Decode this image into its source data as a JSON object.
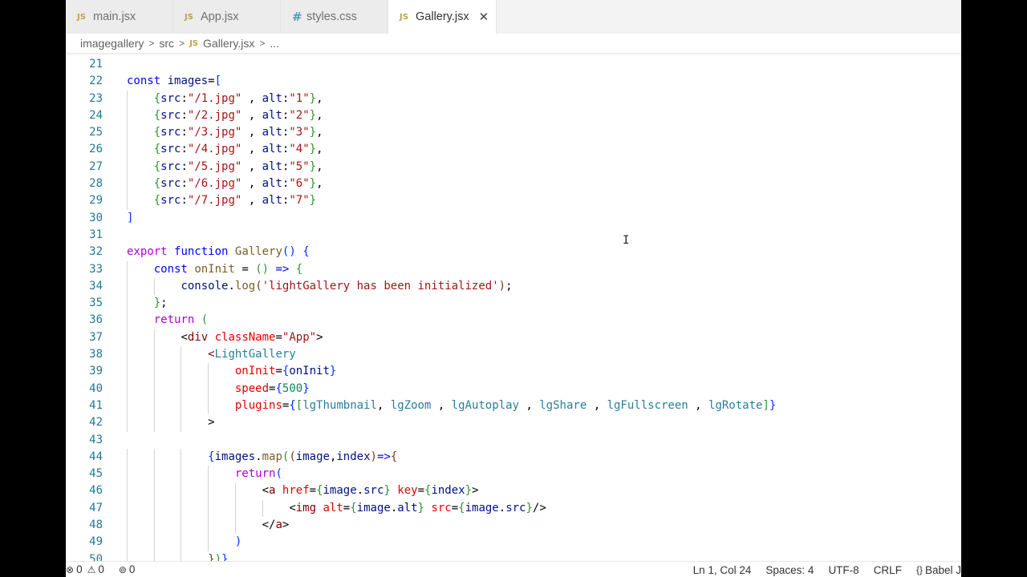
{
  "tabs": [
    {
      "icon": "JS",
      "label": "main.jsx",
      "active": false
    },
    {
      "icon": "JS",
      "label": "App.jsx",
      "active": false
    },
    {
      "icon": "#",
      "label": "styles.css",
      "active": false
    },
    {
      "icon": "JS",
      "label": "Gallery.jsx",
      "active": true,
      "close": "✕"
    }
  ],
  "breadcrumb": {
    "items": [
      "imagegallery",
      "src",
      "Gallery.jsx",
      "..."
    ],
    "file_icon": "JS",
    "separator": ">"
  },
  "editor": {
    "lines": [
      {
        "n": "21",
        "indent": 0,
        "tokens": []
      },
      {
        "n": "22",
        "indent": 0,
        "tokens": [
          [
            "kw",
            "const"
          ],
          [
            "plain",
            " "
          ],
          [
            "var",
            "images"
          ],
          [
            "plain",
            "="
          ],
          [
            "br1",
            "["
          ]
        ]
      },
      {
        "n": "23",
        "indent": 1,
        "tokens": [
          [
            "br2",
            "{"
          ],
          [
            "var",
            "src"
          ],
          [
            "plain",
            ":"
          ],
          [
            "str",
            "\"/1.jpg\""
          ],
          [
            "plain",
            " , "
          ],
          [
            "var",
            "alt"
          ],
          [
            "plain",
            ":"
          ],
          [
            "str",
            "\"1\""
          ],
          [
            "br2",
            "}"
          ],
          [
            "plain",
            ","
          ]
        ]
      },
      {
        "n": "24",
        "indent": 1,
        "tokens": [
          [
            "br2",
            "{"
          ],
          [
            "var",
            "src"
          ],
          [
            "plain",
            ":"
          ],
          [
            "str",
            "\"/2.jpg\""
          ],
          [
            "plain",
            " , "
          ],
          [
            "var",
            "alt"
          ],
          [
            "plain",
            ":"
          ],
          [
            "str",
            "\"2\""
          ],
          [
            "br2",
            "}"
          ],
          [
            "plain",
            ","
          ]
        ]
      },
      {
        "n": "25",
        "indent": 1,
        "tokens": [
          [
            "br2",
            "{"
          ],
          [
            "var",
            "src"
          ],
          [
            "plain",
            ":"
          ],
          [
            "str",
            "\"/3.jpg\""
          ],
          [
            "plain",
            " , "
          ],
          [
            "var",
            "alt"
          ],
          [
            "plain",
            ":"
          ],
          [
            "str",
            "\"3\""
          ],
          [
            "br2",
            "}"
          ],
          [
            "plain",
            ","
          ]
        ]
      },
      {
        "n": "26",
        "indent": 1,
        "tokens": [
          [
            "br2",
            "{"
          ],
          [
            "var",
            "src"
          ],
          [
            "plain",
            ":"
          ],
          [
            "str",
            "\"/4.jpg\""
          ],
          [
            "plain",
            " , "
          ],
          [
            "var",
            "alt"
          ],
          [
            "plain",
            ":"
          ],
          [
            "str",
            "\"4\""
          ],
          [
            "br2",
            "}"
          ],
          [
            "plain",
            ","
          ]
        ]
      },
      {
        "n": "27",
        "indent": 1,
        "tokens": [
          [
            "br2",
            "{"
          ],
          [
            "var",
            "src"
          ],
          [
            "plain",
            ":"
          ],
          [
            "str",
            "\"/5.jpg\""
          ],
          [
            "plain",
            " , "
          ],
          [
            "var",
            "alt"
          ],
          [
            "plain",
            ":"
          ],
          [
            "str",
            "\"5\""
          ],
          [
            "br2",
            "}"
          ],
          [
            "plain",
            ","
          ]
        ]
      },
      {
        "n": "28",
        "indent": 1,
        "tokens": [
          [
            "br2",
            "{"
          ],
          [
            "var",
            "src"
          ],
          [
            "plain",
            ":"
          ],
          [
            "str",
            "\"/6.jpg\""
          ],
          [
            "plain",
            " , "
          ],
          [
            "var",
            "alt"
          ],
          [
            "plain",
            ":"
          ],
          [
            "str",
            "\"6\""
          ],
          [
            "br2",
            "}"
          ],
          [
            "plain",
            ","
          ]
        ]
      },
      {
        "n": "29",
        "indent": 1,
        "tokens": [
          [
            "br2",
            "{"
          ],
          [
            "var",
            "src"
          ],
          [
            "plain",
            ":"
          ],
          [
            "str",
            "\"/7.jpg\""
          ],
          [
            "plain",
            " , "
          ],
          [
            "var",
            "alt"
          ],
          [
            "plain",
            ":"
          ],
          [
            "str",
            "\"7\""
          ],
          [
            "br2",
            "}"
          ]
        ]
      },
      {
        "n": "30",
        "indent": 0,
        "tokens": [
          [
            "br1",
            "]"
          ]
        ]
      },
      {
        "n": "31",
        "indent": 0,
        "tokens": []
      },
      {
        "n": "32",
        "indent": 0,
        "tokens": [
          [
            "kw2",
            "export"
          ],
          [
            "plain",
            " "
          ],
          [
            "kw",
            "function"
          ],
          [
            "plain",
            " "
          ],
          [
            "fn",
            "Gallery"
          ],
          [
            "br1",
            "()"
          ],
          [
            "plain",
            " "
          ],
          [
            "br1",
            "{"
          ]
        ]
      },
      {
        "n": "33",
        "indent": 1,
        "tokens": [
          [
            "kw",
            "const"
          ],
          [
            "plain",
            " "
          ],
          [
            "fn",
            "onInit"
          ],
          [
            "plain",
            " = "
          ],
          [
            "br2",
            "()"
          ],
          [
            "plain",
            " "
          ],
          [
            "kw",
            "=>"
          ],
          [
            "plain",
            " "
          ],
          [
            "br2",
            "{"
          ]
        ]
      },
      {
        "n": "34",
        "indent": 2,
        "tokens": [
          [
            "var",
            "console"
          ],
          [
            "plain",
            "."
          ],
          [
            "fn",
            "log"
          ],
          [
            "br3",
            "("
          ],
          [
            "str",
            "'lightGallery has been initialized'"
          ],
          [
            "br3",
            ")"
          ],
          [
            "plain",
            ";"
          ]
        ]
      },
      {
        "n": "35",
        "indent": 1,
        "tokens": [
          [
            "br2",
            "}"
          ],
          [
            "plain",
            ";"
          ]
        ]
      },
      {
        "n": "36",
        "indent": 1,
        "tokens": [
          [
            "kw2",
            "return"
          ],
          [
            "plain",
            " "
          ],
          [
            "br2",
            "("
          ]
        ]
      },
      {
        "n": "37",
        "indent": 2,
        "tokens": [
          [
            "plain",
            "<"
          ],
          [
            "tag",
            "div"
          ],
          [
            "plain",
            " "
          ],
          [
            "attr",
            "className"
          ],
          [
            "plain",
            "="
          ],
          [
            "str",
            "\"App\""
          ],
          [
            "plain",
            ">"
          ]
        ]
      },
      {
        "n": "38",
        "indent": 3,
        "tokens": [
          [
            "tag",
            "<"
          ],
          [
            "comp",
            "LightGallery"
          ]
        ]
      },
      {
        "n": "39",
        "indent": 4,
        "tokens": [
          [
            "attr",
            "onInit"
          ],
          [
            "plain",
            "="
          ],
          [
            "br1",
            "{"
          ],
          [
            "var",
            "onInit"
          ],
          [
            "br1",
            "}"
          ]
        ]
      },
      {
        "n": "40",
        "indent": 4,
        "tokens": [
          [
            "attr",
            "speed"
          ],
          [
            "plain",
            "="
          ],
          [
            "br1",
            "{"
          ],
          [
            "num",
            "500"
          ],
          [
            "br1",
            "}"
          ]
        ]
      },
      {
        "n": "41",
        "indent": 4,
        "tokens": [
          [
            "attr",
            "plugins"
          ],
          [
            "plain",
            "="
          ],
          [
            "br1",
            "{"
          ],
          [
            "br2",
            "["
          ],
          [
            "comp",
            "lgThumbnail"
          ],
          [
            "plain",
            ", "
          ],
          [
            "comp",
            "lgZoom"
          ],
          [
            "plain",
            " , "
          ],
          [
            "comp",
            "lgAutoplay"
          ],
          [
            "plain",
            " , "
          ],
          [
            "comp",
            "lgShare"
          ],
          [
            "plain",
            " , "
          ],
          [
            "comp",
            "lgFullscreen"
          ],
          [
            "plain",
            " , "
          ],
          [
            "comp",
            "lgRotate"
          ],
          [
            "br2",
            "]"
          ],
          [
            "br1",
            "}"
          ]
        ]
      },
      {
        "n": "42",
        "indent": 3,
        "tokens": [
          [
            "plain",
            ">"
          ]
        ]
      },
      {
        "n": "43",
        "indent": 0,
        "tokens": []
      },
      {
        "n": "44",
        "indent": 3,
        "tokens": [
          [
            "br1",
            "{"
          ],
          [
            "var",
            "images"
          ],
          [
            "plain",
            "."
          ],
          [
            "fn",
            "map"
          ],
          [
            "br2",
            "("
          ],
          [
            "br3",
            "("
          ],
          [
            "var",
            "image"
          ],
          [
            "plain",
            ","
          ],
          [
            "var",
            "index"
          ],
          [
            "br3",
            ")"
          ],
          [
            "kw",
            "=>"
          ],
          [
            "br3",
            "{"
          ]
        ]
      },
      {
        "n": "45",
        "indent": 4,
        "tokens": [
          [
            "kw2",
            "return"
          ],
          [
            "br1",
            "("
          ]
        ]
      },
      {
        "n": "46",
        "indent": 5,
        "tokens": [
          [
            "plain",
            "<"
          ],
          [
            "tag",
            "a"
          ],
          [
            "plain",
            " "
          ],
          [
            "attr",
            "href"
          ],
          [
            "plain",
            "="
          ],
          [
            "br2",
            "{"
          ],
          [
            "var",
            "image"
          ],
          [
            "plain",
            "."
          ],
          [
            "var",
            "src"
          ],
          [
            "br2",
            "}"
          ],
          [
            "plain",
            " "
          ],
          [
            "attr",
            "key"
          ],
          [
            "plain",
            "="
          ],
          [
            "br2",
            "{"
          ],
          [
            "var",
            "index"
          ],
          [
            "br2",
            "}"
          ],
          [
            "plain",
            ">"
          ]
        ]
      },
      {
        "n": "47",
        "indent": 6,
        "tokens": [
          [
            "plain",
            "<"
          ],
          [
            "tag",
            "img"
          ],
          [
            "plain",
            " "
          ],
          [
            "attr",
            "alt"
          ],
          [
            "plain",
            "="
          ],
          [
            "br2",
            "{"
          ],
          [
            "var",
            "image"
          ],
          [
            "plain",
            "."
          ],
          [
            "var",
            "alt"
          ],
          [
            "br2",
            "}"
          ],
          [
            "plain",
            " "
          ],
          [
            "attr",
            "src"
          ],
          [
            "plain",
            "="
          ],
          [
            "br2",
            "{"
          ],
          [
            "var",
            "image"
          ],
          [
            "plain",
            "."
          ],
          [
            "var",
            "src"
          ],
          [
            "br2",
            "}"
          ],
          [
            "plain",
            "/>"
          ]
        ]
      },
      {
        "n": "48",
        "indent": 5,
        "tokens": [
          [
            "plain",
            "</"
          ],
          [
            "tag",
            "a"
          ],
          [
            "plain",
            ">"
          ]
        ]
      },
      {
        "n": "49",
        "indent": 4,
        "tokens": [
          [
            "br1",
            ")"
          ]
        ]
      },
      {
        "n": "50",
        "indent": 3,
        "tokens": [
          [
            "br3",
            "}"
          ],
          [
            "br2",
            ")"
          ],
          [
            "br1",
            "}"
          ]
        ]
      }
    ]
  },
  "statusbar": {
    "errors": "0",
    "warnings": "0",
    "ports": "0",
    "position": "Ln 1, Col 24",
    "spaces": "Spaces: 4",
    "encoding": "UTF-8",
    "eol": "CRLF",
    "language": "Babel J"
  },
  "colors": {
    "keyword": "#0000ff",
    "control_keyword": "#af00db",
    "variable": "#001080",
    "string": "#a31515",
    "function": "#795e26",
    "number": "#098658",
    "tag": "#800000",
    "component": "#267f99",
    "attribute": "#e50000",
    "line_number": "#237893"
  }
}
